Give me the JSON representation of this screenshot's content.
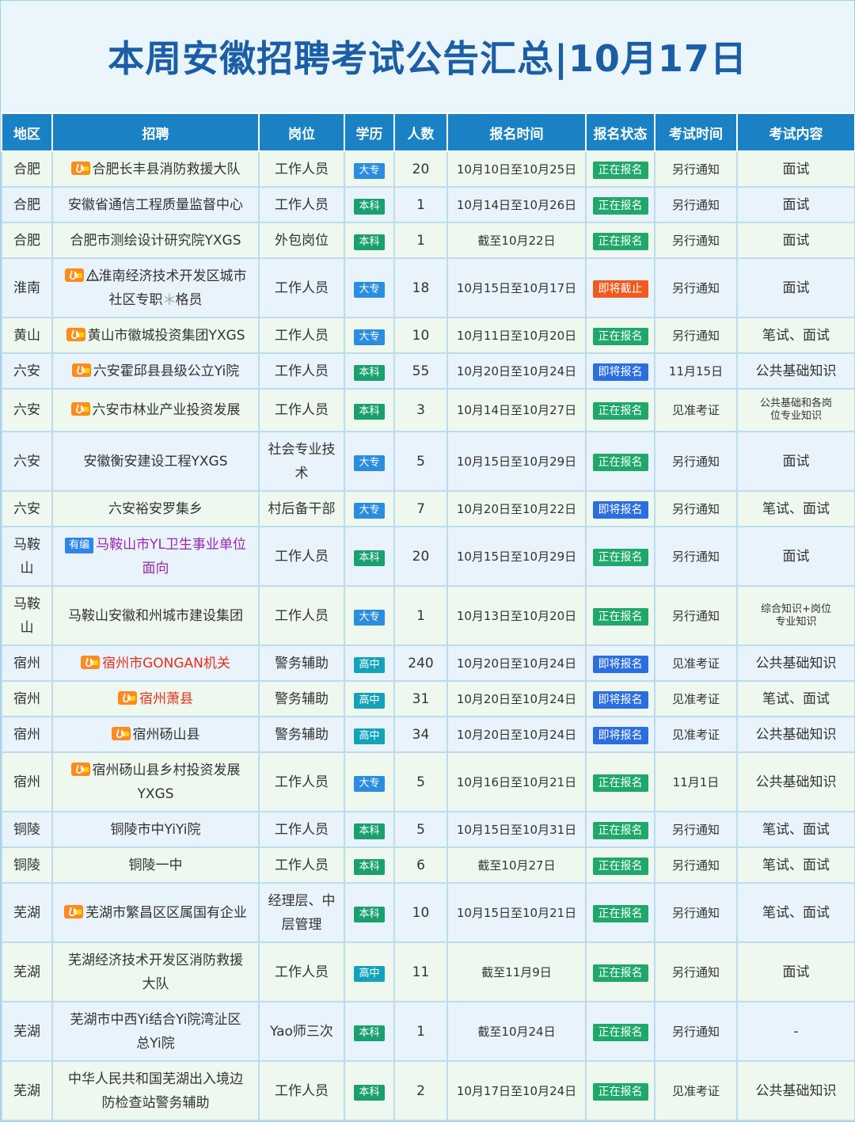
{
  "title": "本周安徽招聘考试公告汇总|10月17日",
  "headers": [
    "地区",
    "招聘",
    "岗位",
    "学历",
    "人数",
    "报名时间",
    "报名状态",
    "考试时间",
    "考试内容"
  ],
  "rows": [
    {
      "region": "合肥",
      "recruit": "合肥长丰县消防救援大队",
      "fire": true,
      "position": "工作人员",
      "edu": "大专",
      "count": "20",
      "reg_time": "10月10日至10月25日",
      "status": "正在报名",
      "exam_time": "另行通知",
      "content": "面试"
    },
    {
      "region": "合肥",
      "recruit": "安徽省通信工程质量监督中心",
      "position": "工作人员",
      "edu": "本科",
      "count": "1",
      "reg_time": "10月14日至10月26日",
      "status": "正在报名",
      "exam_time": "另行通知",
      "content": "面试"
    },
    {
      "region": "合肥",
      "recruit": "合肥市测绘设计研究院YXGS",
      "position": "外包岗位",
      "edu": "本科",
      "count": "1",
      "reg_time": "截至10月22日",
      "status": "正在报名",
      "exam_time": "另行通知",
      "content": "面试"
    },
    {
      "region": "淮南",
      "recruit": "淮南经济技术开发区城市",
      "recruit2": "社区专职",
      "recruit3": "格员",
      "fire": true,
      "warn": true,
      "snow": true,
      "position": "工作人员",
      "edu": "大专",
      "count": "18",
      "reg_time": "10月15日至10月17日",
      "status": "即将截止",
      "exam_time": "另行通知",
      "content": "面试"
    },
    {
      "region": "黄山",
      "recruit": "黄山市徽城投资集团YXGS",
      "fire": true,
      "position": "工作人员",
      "edu": "大专",
      "count": "10",
      "reg_time": "10月11日至10月20日",
      "status": "正在报名",
      "exam_time": "另行通知",
      "content": "笔试、面试"
    },
    {
      "region": "六安",
      "recruit": "六安霍邱县县级公立Yi院",
      "fire": true,
      "position": "工作人员",
      "edu": "本科",
      "count": "55",
      "reg_time": "10月20日至10月24日",
      "status": "即将报名",
      "exam_time": "11月15日",
      "content": "公共基础知识"
    },
    {
      "region": "六安",
      "recruit": "六安市林业产业投资发展",
      "fire": true,
      "position": "工作人员",
      "edu": "本科",
      "count": "3",
      "reg_time": "10月14日至10月27日",
      "status": "正在报名",
      "exam_time": "见准考证",
      "content": "公共基础和各岗",
      "content2": "位专业知识"
    },
    {
      "region": "六安",
      "recruit": "安徽衡安建设工程YXGS",
      "position": "社会专业技",
      "position2": "术",
      "edu": "大专",
      "count": "5",
      "reg_time": "10月15日至10月29日",
      "status": "正在报名",
      "exam_time": "另行通知",
      "content": "面试"
    },
    {
      "region": "六安",
      "recruit": "六安裕安罗集乡",
      "position": "村后备干部",
      "edu": "大专",
      "count": "7",
      "reg_time": "10月20日至10月22日",
      "status": "即将报名",
      "exam_time": "另行通知",
      "content": "笔试、面试"
    },
    {
      "region": "马鞍",
      "region2": "山",
      "recruit": "马鞍山市YL卫生事业单位",
      "recruit2": "面向",
      "tag": "有编",
      "position": "工作人员",
      "edu": "本科",
      "count": "20",
      "reg_time": "10月15日至10月29日",
      "status": "正在报名",
      "exam_time": "另行通知",
      "content": "面试"
    },
    {
      "region": "马鞍",
      "region2": "山",
      "recruit": "马鞍山安徽和州城市建设集团",
      "position": "工作人员",
      "edu": "大专",
      "count": "1",
      "reg_time": "10月13日至10月20日",
      "status": "正在报名",
      "exam_time": "另行通知",
      "content": "综合知识+岗位",
      "content2": "专业知识"
    },
    {
      "region": "宿州",
      "recruit": "宿州市GONGAN机关",
      "fire": true,
      "position": "警务辅助",
      "edu": "高中",
      "count": "240",
      "reg_time": "10月20日至10月24日",
      "status": "即将报名",
      "exam_time": "见准考证",
      "content": "公共基础知识"
    },
    {
      "region": "宿州",
      "recruit": "宿州萧县",
      "fire": true,
      "position": "警务辅助",
      "edu": "高中",
      "count": "31",
      "reg_time": "10月20日至10月24日",
      "status": "即将报名",
      "exam_time": "见准考证",
      "content": "笔试、面试"
    },
    {
      "region": "宿州",
      "recruit": "宿州砀山县",
      "fire": true,
      "position": "警务辅助",
      "edu": "高中",
      "count": "34",
      "reg_time": "10月20日至10月24日",
      "status": "即将报名",
      "exam_time": "见准考证",
      "content": "公共基础知识"
    },
    {
      "region": "宿州",
      "recruit": "宿州砀山县乡村投资发展",
      "recruit2": "YXGS",
      "fire": true,
      "position": "工作人员",
      "edu": "大专",
      "count": "5",
      "reg_time": "10月16日至10月21日",
      "status": "正在报名",
      "exam_time": "11月1日",
      "content": "公共基础知识"
    },
    {
      "region": "铜陵",
      "recruit": "铜陵市中YiYi院",
      "position": "工作人员",
      "edu": "本科",
      "count": "5",
      "reg_time": "10月15日至10月31日",
      "status": "正在报名",
      "exam_time": "另行通知",
      "content": "笔试、面试"
    },
    {
      "region": "铜陵",
      "recruit": "铜陵一中",
      "position": "工作人员",
      "edu": "本科",
      "count": "6",
      "reg_time": "截至10月27日",
      "status": "正在报名",
      "exam_time": "另行通知",
      "content": "笔试、面试"
    },
    {
      "region": "芜湖",
      "recruit": "芜湖市繁昌区区属国有企业",
      "fire": true,
      "position": "经理层、中",
      "position2": "层管理",
      "edu": "本科",
      "count": "10",
      "reg_time": "10月15日至10月21日",
      "status": "正在报名",
      "exam_time": "另行通知",
      "content": "笔试、面试"
    },
    {
      "region": "芜湖",
      "recruit": "芜湖经济技术开发区消防救援",
      "recruit2": "大队",
      "position": "工作人员",
      "edu": "高中",
      "count": "11",
      "reg_time": "截至11月9日",
      "status": "正在报名",
      "exam_time": "另行通知",
      "content": "面试"
    },
    {
      "region": "芜湖",
      "recruit": "芜湖市中西Yi结合Yi院湾沚区",
      "recruit2": "总Yi院",
      "position": "Yao师三次",
      "edu": "本科",
      "count": "1",
      "reg_time": "截至10月24日",
      "status": "正在报名",
      "exam_time": "另行通知",
      "content": "-"
    },
    {
      "region": "芜湖",
      "recruit": "中华人民共和国芜湖出入境边",
      "recruit2": "防检查站警务辅助",
      "position": "工作人员",
      "edu": "本科",
      "count": "2",
      "reg_time": "10月17日至10月24日",
      "status": "正在报名",
      "exam_time": "见准考证",
      "content": "公共基础知识"
    }
  ],
  "colors": {
    "header_bg": "#1a82c4",
    "title": "#1b5ea6",
    "edu_dazhuan": "#2a8de0",
    "edu_benke": "#19a06e",
    "edu_gaozhong": "#13a3b8",
    "status_open": "#1fa86a",
    "status_soon": "#2b6ee0",
    "status_closing": "#f05a1e"
  },
  "icons": {
    "fire": "fire-badge-icon",
    "warn": "warning-triangle-icon",
    "snow": "snowflake-icon"
  }
}
